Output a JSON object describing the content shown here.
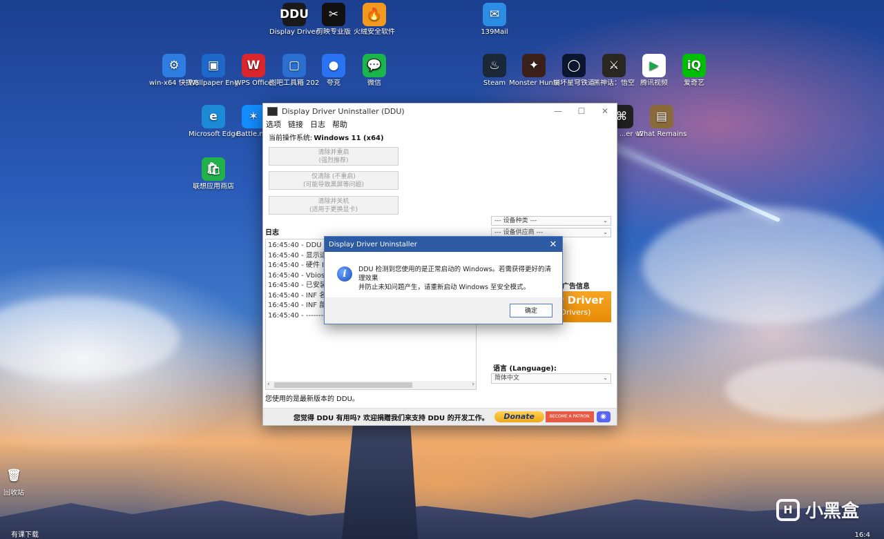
{
  "desktop": {
    "icons_top": [
      {
        "label": "Display Driver U...",
        "glyph": "DDU",
        "color": "#1a1a1a",
        "icon": "ddu-icon"
      },
      {
        "label": "剪映专业版",
        "glyph": "✂",
        "color": "#111111",
        "icon": "capcut-icon"
      },
      {
        "label": "火绒安全软件",
        "glyph": "🔥",
        "color": "#f39a1e",
        "icon": "shield-icon"
      },
      {
        "label": "139Mail",
        "glyph": "✉",
        "color": "#2b8de3",
        "icon": "mail-icon"
      }
    ],
    "icons_row2": [
      {
        "label": "win-x64 快捷方式",
        "glyph": "⚙",
        "color": "#2f7de1",
        "icon": "gear-icon"
      },
      {
        "label": "Wallpaper Engine",
        "glyph": "▣",
        "color": "#1d68c9",
        "icon": "wallpaper-icon"
      },
      {
        "label": "WPS Office",
        "glyph": "W",
        "color": "#d9262c",
        "icon": "wps-icon"
      },
      {
        "label": "图吧工具箱 2025",
        "glyph": "▢",
        "color": "#2a6fcf",
        "icon": "toolbox-icon"
      },
      {
        "label": "夸克",
        "glyph": "●",
        "color": "#2a74f3",
        "icon": "quark-icon"
      },
      {
        "label": "微信",
        "glyph": "💬",
        "color": "#1bb64b",
        "icon": "wechat-icon"
      },
      {
        "label": "Steam",
        "glyph": "♨",
        "color": "#1b2838",
        "icon": "steam-icon"
      },
      {
        "label": "Monster Hunter...",
        "glyph": "✦",
        "color": "#3a1f1a",
        "icon": "game-icon"
      },
      {
        "label": "崩坏星穹铁道",
        "glyph": "◯",
        "color": "#0c1630",
        "icon": "game-icon"
      },
      {
        "label": "黑神话：悟空",
        "glyph": "⚔",
        "color": "#2a2622",
        "icon": "game-icon"
      },
      {
        "label": "腾讯视频",
        "glyph": "▶",
        "color": "#ffffff",
        "icon": "video-icon"
      },
      {
        "label": "爱奇艺",
        "glyph": "iQ",
        "color": "#00be06",
        "icon": "iqiyi-icon"
      }
    ],
    "icons_col1": [
      {
        "label": "Microsoft Edge",
        "glyph": "e",
        "color": "#1c8ad4",
        "icon": "edge-icon"
      },
      {
        "label": "联想应用商店",
        "glyph": "🛍",
        "color": "#22b24c",
        "icon": "store-icon"
      }
    ],
    "icons_col2": [
      {
        "label": "Battle.net",
        "glyph": "✶",
        "color": "#148eff",
        "icon": "battlenet-icon"
      }
    ],
    "icons_right": [
      {
        "label": "Hdox ...er v2",
        "glyph": "⌘",
        "color": "#222222",
        "icon": "app-icon"
      },
      {
        "label": "What Remains",
        "glyph": "▤",
        "color": "#8a6a3a",
        "icon": "game-icon"
      }
    ],
    "recycle_bin": {
      "label": "回收站",
      "glyph": "🗑",
      "icon": "recycle-bin-icon"
    },
    "watermark": {
      "text": "小黑盒",
      "logo": "H",
      "icon": "heybox-logo-icon"
    }
  },
  "ddu_window": {
    "title": "Display Driver Uninstaller (DDU)",
    "menu": [
      "选项",
      "链接",
      "日志",
      "帮助"
    ],
    "os_label": "当前操作系统:",
    "os_value": "Windows 11 (x64)",
    "buttons": [
      {
        "line1": "清除并重启",
        "line2": "(强烈推荐)"
      },
      {
        "line1": "仅清除 (不重启)",
        "line2": "(可能导致黑屏等问题)"
      },
      {
        "line1": "清除并关机",
        "line2": "(适用于更换显卡)"
      }
    ],
    "log_label": "日志",
    "log_lines": [
      "16:45:40 - DDU 版本",
      "16:45:40 - 显示适配",
      "16:45:40 - 硬件 ID: p",
      "16:45:40 - Vbios: V",
      "16:45:40 - 已安装的",
      "16:45:40 - INF 名称:",
      "16:45:40 - INF 部分:",
      "16:45:40 - ---------"
    ],
    "device_type": "--- 设备种类 ---",
    "device_vendor": "--- 设备供应商 ---",
    "ad_label": "广告信息",
    "banner_line1": "ay Driver",
    "banner_line2": "re Drivers)",
    "language_label": "语言 (Language):",
    "language_value": "简体中文",
    "status": "您使用的是最新版本的 DDU。",
    "support_msg": "您觉得 DDU 有用吗? 欢迎捐赠我们来支持 DDU 的开发工作。",
    "donate_label": "Donate",
    "patreon_label": "BECOME A PATRON",
    "discord_glyph": "◉"
  },
  "dialog": {
    "title": "Display Driver Uninstaller",
    "message_line1": "DDU 检测到您使用的是正常启动的 Windows。若需获得更好的清理效果",
    "message_line2": "并防止未知问题产生，请重新启动 Windows 至安全模式。",
    "ok": "确定",
    "close": "✕",
    "info_glyph": "i"
  },
  "taskbar": {
    "left_text": "有课下载",
    "right_text": "16:4"
  },
  "colors": {
    "dialog_title": "#2c5aa3",
    "banner": "#f6a623",
    "donate": "#f0a81b"
  }
}
